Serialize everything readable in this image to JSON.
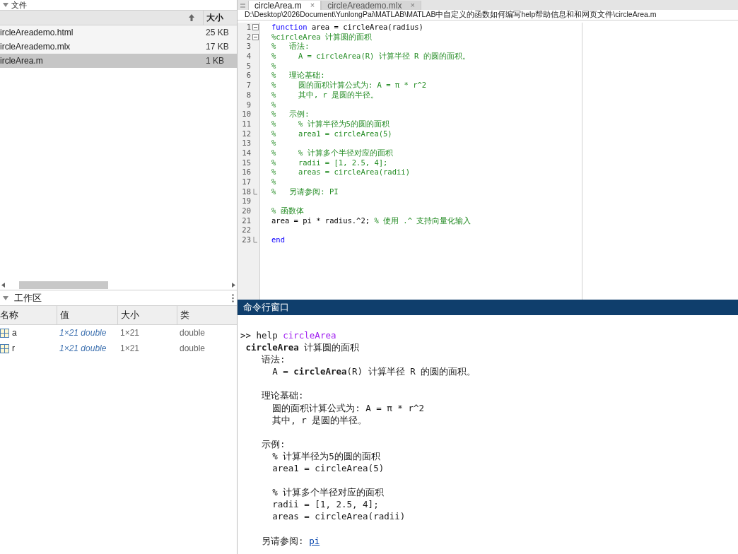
{
  "file_browser": {
    "title": "文件",
    "size_header": "大小",
    "files": [
      {
        "name": "ircleAreademo.html",
        "size": "25 KB",
        "selected": false
      },
      {
        "name": "ircleAreademo.mlx",
        "size": "17 KB",
        "selected": false
      },
      {
        "name": "ircleArea.m",
        "size": "1 KB",
        "selected": true
      }
    ]
  },
  "workspace": {
    "title": "工作区",
    "columns": [
      "名称",
      "值",
      "大小",
      "类"
    ],
    "rows": [
      {
        "name": "a",
        "value": "1×21 double",
        "size": "1×21",
        "class": "double"
      },
      {
        "name": "r",
        "value": "1×21 double",
        "size": "1×21",
        "class": "double"
      }
    ]
  },
  "editor": {
    "tabs": [
      {
        "label": "circleArea.m",
        "close": "×",
        "selected": true
      },
      {
        "label": "circleAreademo.mlx",
        "close": "×",
        "selected": false
      }
    ],
    "path": "D:\\Desktop\\2026Document\\YunlongPai\\MATLAB\\MATLAB中自定义的函数如何编写help帮助信息和和网页文件\\circleArea.m",
    "lines": [
      {
        "num": "1",
        "kind": "fold_start",
        "segments": [
          {
            "kind": "keyword",
            "text": "function"
          },
          {
            "kind": "code",
            "text": " area = circleArea(radius)"
          }
        ]
      },
      {
        "num": "2",
        "kind": "fold_start",
        "segments": [
          {
            "kind": "comment",
            "text": "%circleArea 计算圆的面积"
          }
        ]
      },
      {
        "num": "3",
        "segments": [
          {
            "kind": "comment",
            "text": "%   语法:"
          }
        ]
      },
      {
        "num": "4",
        "segments": [
          {
            "kind": "comment",
            "text": "%     A = circleArea(R) 计算半径 R 的圆的面积。"
          }
        ]
      },
      {
        "num": "5",
        "segments": [
          {
            "kind": "comment",
            "text": "%"
          }
        ]
      },
      {
        "num": "6",
        "segments": [
          {
            "kind": "comment",
            "text": "%   理论基础:"
          }
        ]
      },
      {
        "num": "7",
        "segments": [
          {
            "kind": "comment",
            "text": "%     圆的面积计算公式为: A = π * r^2"
          }
        ]
      },
      {
        "num": "8",
        "segments": [
          {
            "kind": "comment",
            "text": "%     其中, r 是圆的半径。"
          }
        ]
      },
      {
        "num": "9",
        "segments": [
          {
            "kind": "comment",
            "text": "%"
          }
        ]
      },
      {
        "num": "10",
        "segments": [
          {
            "kind": "comment",
            "text": "%   示例:"
          }
        ]
      },
      {
        "num": "11",
        "segments": [
          {
            "kind": "comment",
            "text": "%     % 计算半径为5的圆的面积"
          }
        ]
      },
      {
        "num": "12",
        "segments": [
          {
            "kind": "comment",
            "text": "%     area1 = circleArea(5)"
          }
        ]
      },
      {
        "num": "13",
        "segments": [
          {
            "kind": "comment",
            "text": "%"
          }
        ]
      },
      {
        "num": "14",
        "segments": [
          {
            "kind": "comment",
            "text": "%     % 计算多个半径对应的面积"
          }
        ]
      },
      {
        "num": "15",
        "segments": [
          {
            "kind": "comment",
            "text": "%     radii = [1, 2.5, 4];"
          }
        ]
      },
      {
        "num": "16",
        "segments": [
          {
            "kind": "comment",
            "text": "%     areas = circleArea(radii)"
          }
        ]
      },
      {
        "num": "17",
        "segments": [
          {
            "kind": "comment",
            "text": "%"
          }
        ]
      },
      {
        "num": "18",
        "kind": "fold_end",
        "segments": [
          {
            "kind": "comment",
            "text": "%   另请参阅: PI"
          }
        ]
      },
      {
        "num": "19"
      },
      {
        "num": "20",
        "segments": [
          {
            "kind": "comment",
            "text": "% 函数体"
          }
        ]
      },
      {
        "num": "21",
        "segments": [
          {
            "kind": "code",
            "text": "area = pi * radius.^2; "
          },
          {
            "kind": "comment",
            "text": "% 使用 .^ 支持向量化输入"
          }
        ]
      },
      {
        "num": "22"
      },
      {
        "num": "23",
        "kind": "fold_end",
        "segments": [
          {
            "kind": "keyword",
            "text": "end"
          }
        ]
      }
    ]
  },
  "command_window": {
    "title": "命令行窗口",
    "lines": [
      {
        "segments": [
          {
            "kind": "plain",
            "text": ">> help "
          },
          {
            "kind": "argument",
            "text": "circleArea"
          }
        ]
      },
      {
        "segments": [
          {
            "kind": "bold",
            "text": " circleArea"
          },
          {
            "kind": "plain",
            "text": " 计算圆的面积"
          }
        ]
      },
      {
        "segments": [
          {
            "kind": "plain",
            "text": "    语法:"
          }
        ]
      },
      {
        "segments": [
          {
            "kind": "plain",
            "text": "      A = "
          },
          {
            "kind": "bold",
            "text": "circleArea"
          },
          {
            "kind": "plain",
            "text": "(R) 计算半径 R 的圆的面积。"
          }
        ]
      },
      {
        "kind": "blank"
      },
      {
        "segments": [
          {
            "kind": "plain",
            "text": "    理论基础:"
          }
        ]
      },
      {
        "segments": [
          {
            "kind": "plain",
            "text": "      圆的面积计算公式为: A = π * r^2"
          }
        ]
      },
      {
        "segments": [
          {
            "kind": "plain",
            "text": "      其中, r 是圆的半径。"
          }
        ]
      },
      {
        "kind": "blank"
      },
      {
        "segments": [
          {
            "kind": "plain",
            "text": "    示例:"
          }
        ]
      },
      {
        "segments": [
          {
            "kind": "plain",
            "text": "      % 计算半径为5的圆的面积"
          }
        ]
      },
      {
        "segments": [
          {
            "kind": "plain",
            "text": "      area1 = circleArea(5)"
          }
        ]
      },
      {
        "kind": "blank"
      },
      {
        "segments": [
          {
            "kind": "plain",
            "text": "      % 计算多个半径对应的面积"
          }
        ]
      },
      {
        "segments": [
          {
            "kind": "plain",
            "text": "      radii = [1, 2.5, 4];"
          }
        ]
      },
      {
        "segments": [
          {
            "kind": "plain",
            "text": "      areas = circleArea(radii)"
          }
        ]
      },
      {
        "kind": "blank"
      },
      {
        "segments": [
          {
            "kind": "plain",
            "text": "    另请参阅: "
          },
          {
            "kind": "link",
            "text": "pi"
          }
        ]
      }
    ]
  }
}
